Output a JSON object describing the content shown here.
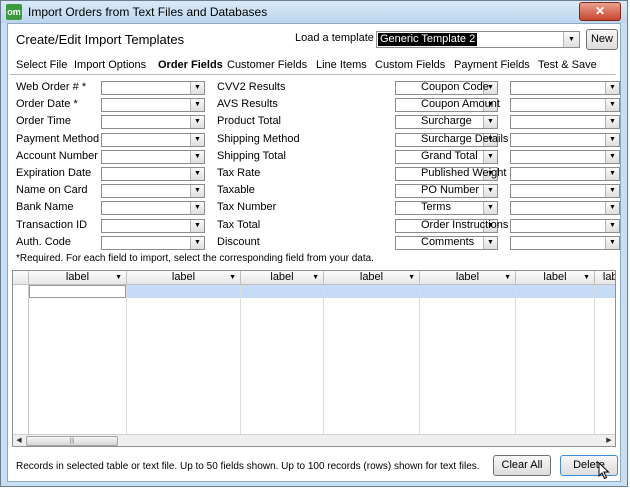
{
  "window": {
    "title": "Import Orders from Text Files and Databases",
    "app_icon_text": "om",
    "close_label": "✕"
  },
  "header": {
    "heading": "Create/Edit Import Templates",
    "load_label": "Load a template",
    "template_value": "Generic Template 2",
    "new_label": "New"
  },
  "tabs": [
    {
      "label": "Select File",
      "active": false
    },
    {
      "label": "Import Options",
      "active": false
    },
    {
      "label": "Order Fields",
      "active": true
    },
    {
      "label": "Customer Fields",
      "active": false
    },
    {
      "label": "Line Items",
      "active": false
    },
    {
      "label": "Custom Fields",
      "active": false
    },
    {
      "label": "Payment Fields",
      "active": false
    },
    {
      "label": "Test & Save",
      "active": false
    }
  ],
  "fields": {
    "col1": [
      "Web Order # *",
      "Order Date *",
      "Order Time",
      "Payment Method",
      "Account Number",
      "Expiration Date",
      "Name on Card",
      "Bank Name",
      "Transaction ID",
      "Auth. Code"
    ],
    "col2": [
      "CVV2 Results",
      "AVS Results",
      "Product Total",
      "Shipping Method",
      "Shipping Total",
      "Tax Rate",
      "Taxable",
      "Tax Number",
      "Tax Total",
      "Discount"
    ],
    "col3": [
      "Coupon Code",
      "Coupon Amount",
      "Surcharge",
      "Surcharge Details",
      "Grand Total",
      "Published Weight",
      "PO Number",
      "Terms",
      "Order Instructions",
      "Comments"
    ]
  },
  "note": "*Required.  For each field to import, select the corresponding field from your data.",
  "grid": {
    "columns": [
      "label",
      "label",
      "label",
      "label",
      "label",
      "label",
      "label"
    ]
  },
  "footer": {
    "info": "Records in selected table or text file. Up to 50 fields shown. Up to 100 records (rows) shown for text files.",
    "clear_label": "Clear All",
    "delete_label": "Delete"
  }
}
